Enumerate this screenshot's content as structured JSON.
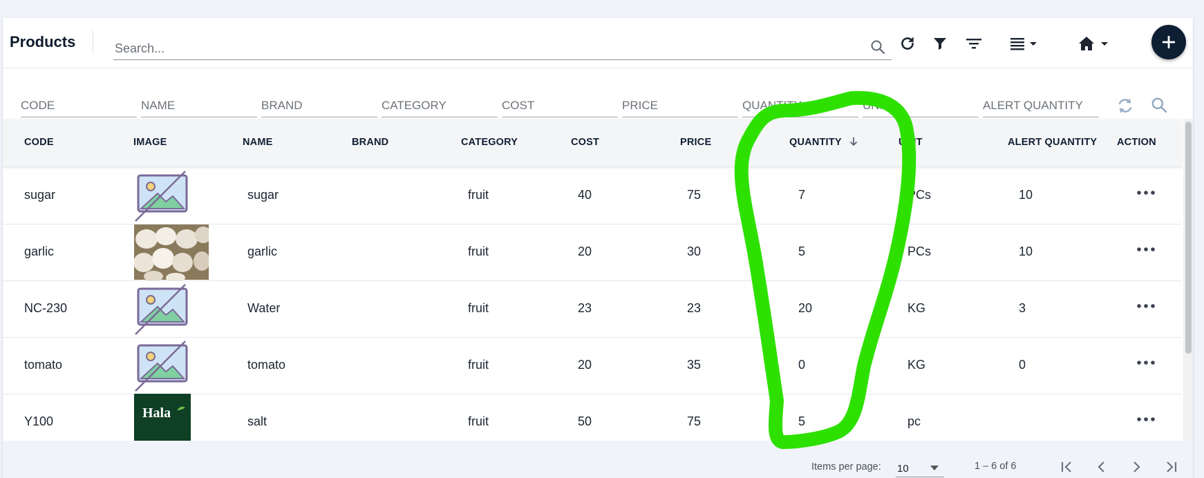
{
  "toolbar": {
    "title": "Products",
    "search_placeholder": "Search..."
  },
  "filters": {
    "code": "CODE",
    "name": "NAME",
    "brand": "BRAND",
    "category": "CATEGORY",
    "cost": "COST",
    "price": "PRICE",
    "quantity": "QUANTITY",
    "unit": "UNIT",
    "alert_quantity": "ALERT QUANTITY"
  },
  "table": {
    "headers": {
      "code": "CODE",
      "image": "IMAGE",
      "name": "NAME",
      "brand": "BRAND",
      "category": "CATEGORY",
      "cost": "COST",
      "price": "PRICE",
      "quantity": "QUANTITY",
      "unit": "UNIT",
      "alert_quantity": "ALERT QUANTITY",
      "action": "ACTION"
    },
    "sort": {
      "column": "quantity",
      "direction": "desc"
    },
    "rows": [
      {
        "code": "sugar",
        "image": "placeholder",
        "name": "sugar",
        "brand": "",
        "category": "fruit",
        "cost": "40",
        "price": "75",
        "quantity": "7",
        "unit": "PCs",
        "alert_quantity": "10"
      },
      {
        "code": "garlic",
        "image": "garlic-photo",
        "name": "garlic",
        "brand": "",
        "category": "fruit",
        "cost": "20",
        "price": "30",
        "quantity": "5",
        "unit": "PCs",
        "alert_quantity": "10"
      },
      {
        "code": "NC-230",
        "image": "placeholder",
        "name": "Water",
        "brand": "",
        "category": "fruit",
        "cost": "23",
        "price": "23",
        "quantity": "20",
        "unit": "KG",
        "alert_quantity": "3"
      },
      {
        "code": "tomato",
        "image": "placeholder",
        "name": "tomato",
        "brand": "",
        "category": "fruit",
        "cost": "20",
        "price": "35",
        "quantity": "0",
        "unit": "KG",
        "alert_quantity": "0"
      },
      {
        "code": "Y100",
        "image": "hala-logo",
        "logo_text": "Hala",
        "name": "salt",
        "brand": "",
        "category": "fruit",
        "cost": "50",
        "price": "75",
        "quantity": "5",
        "unit": "pc",
        "alert_quantity": ""
      }
    ]
  },
  "paginator": {
    "items_per_page_label": "Items per page:",
    "page_size": "10",
    "range_label": "1 – 6 of 6"
  },
  "colors": {
    "primary": "#0e1e33",
    "annotation": "#2ee000",
    "background": "#f0f4fa"
  }
}
